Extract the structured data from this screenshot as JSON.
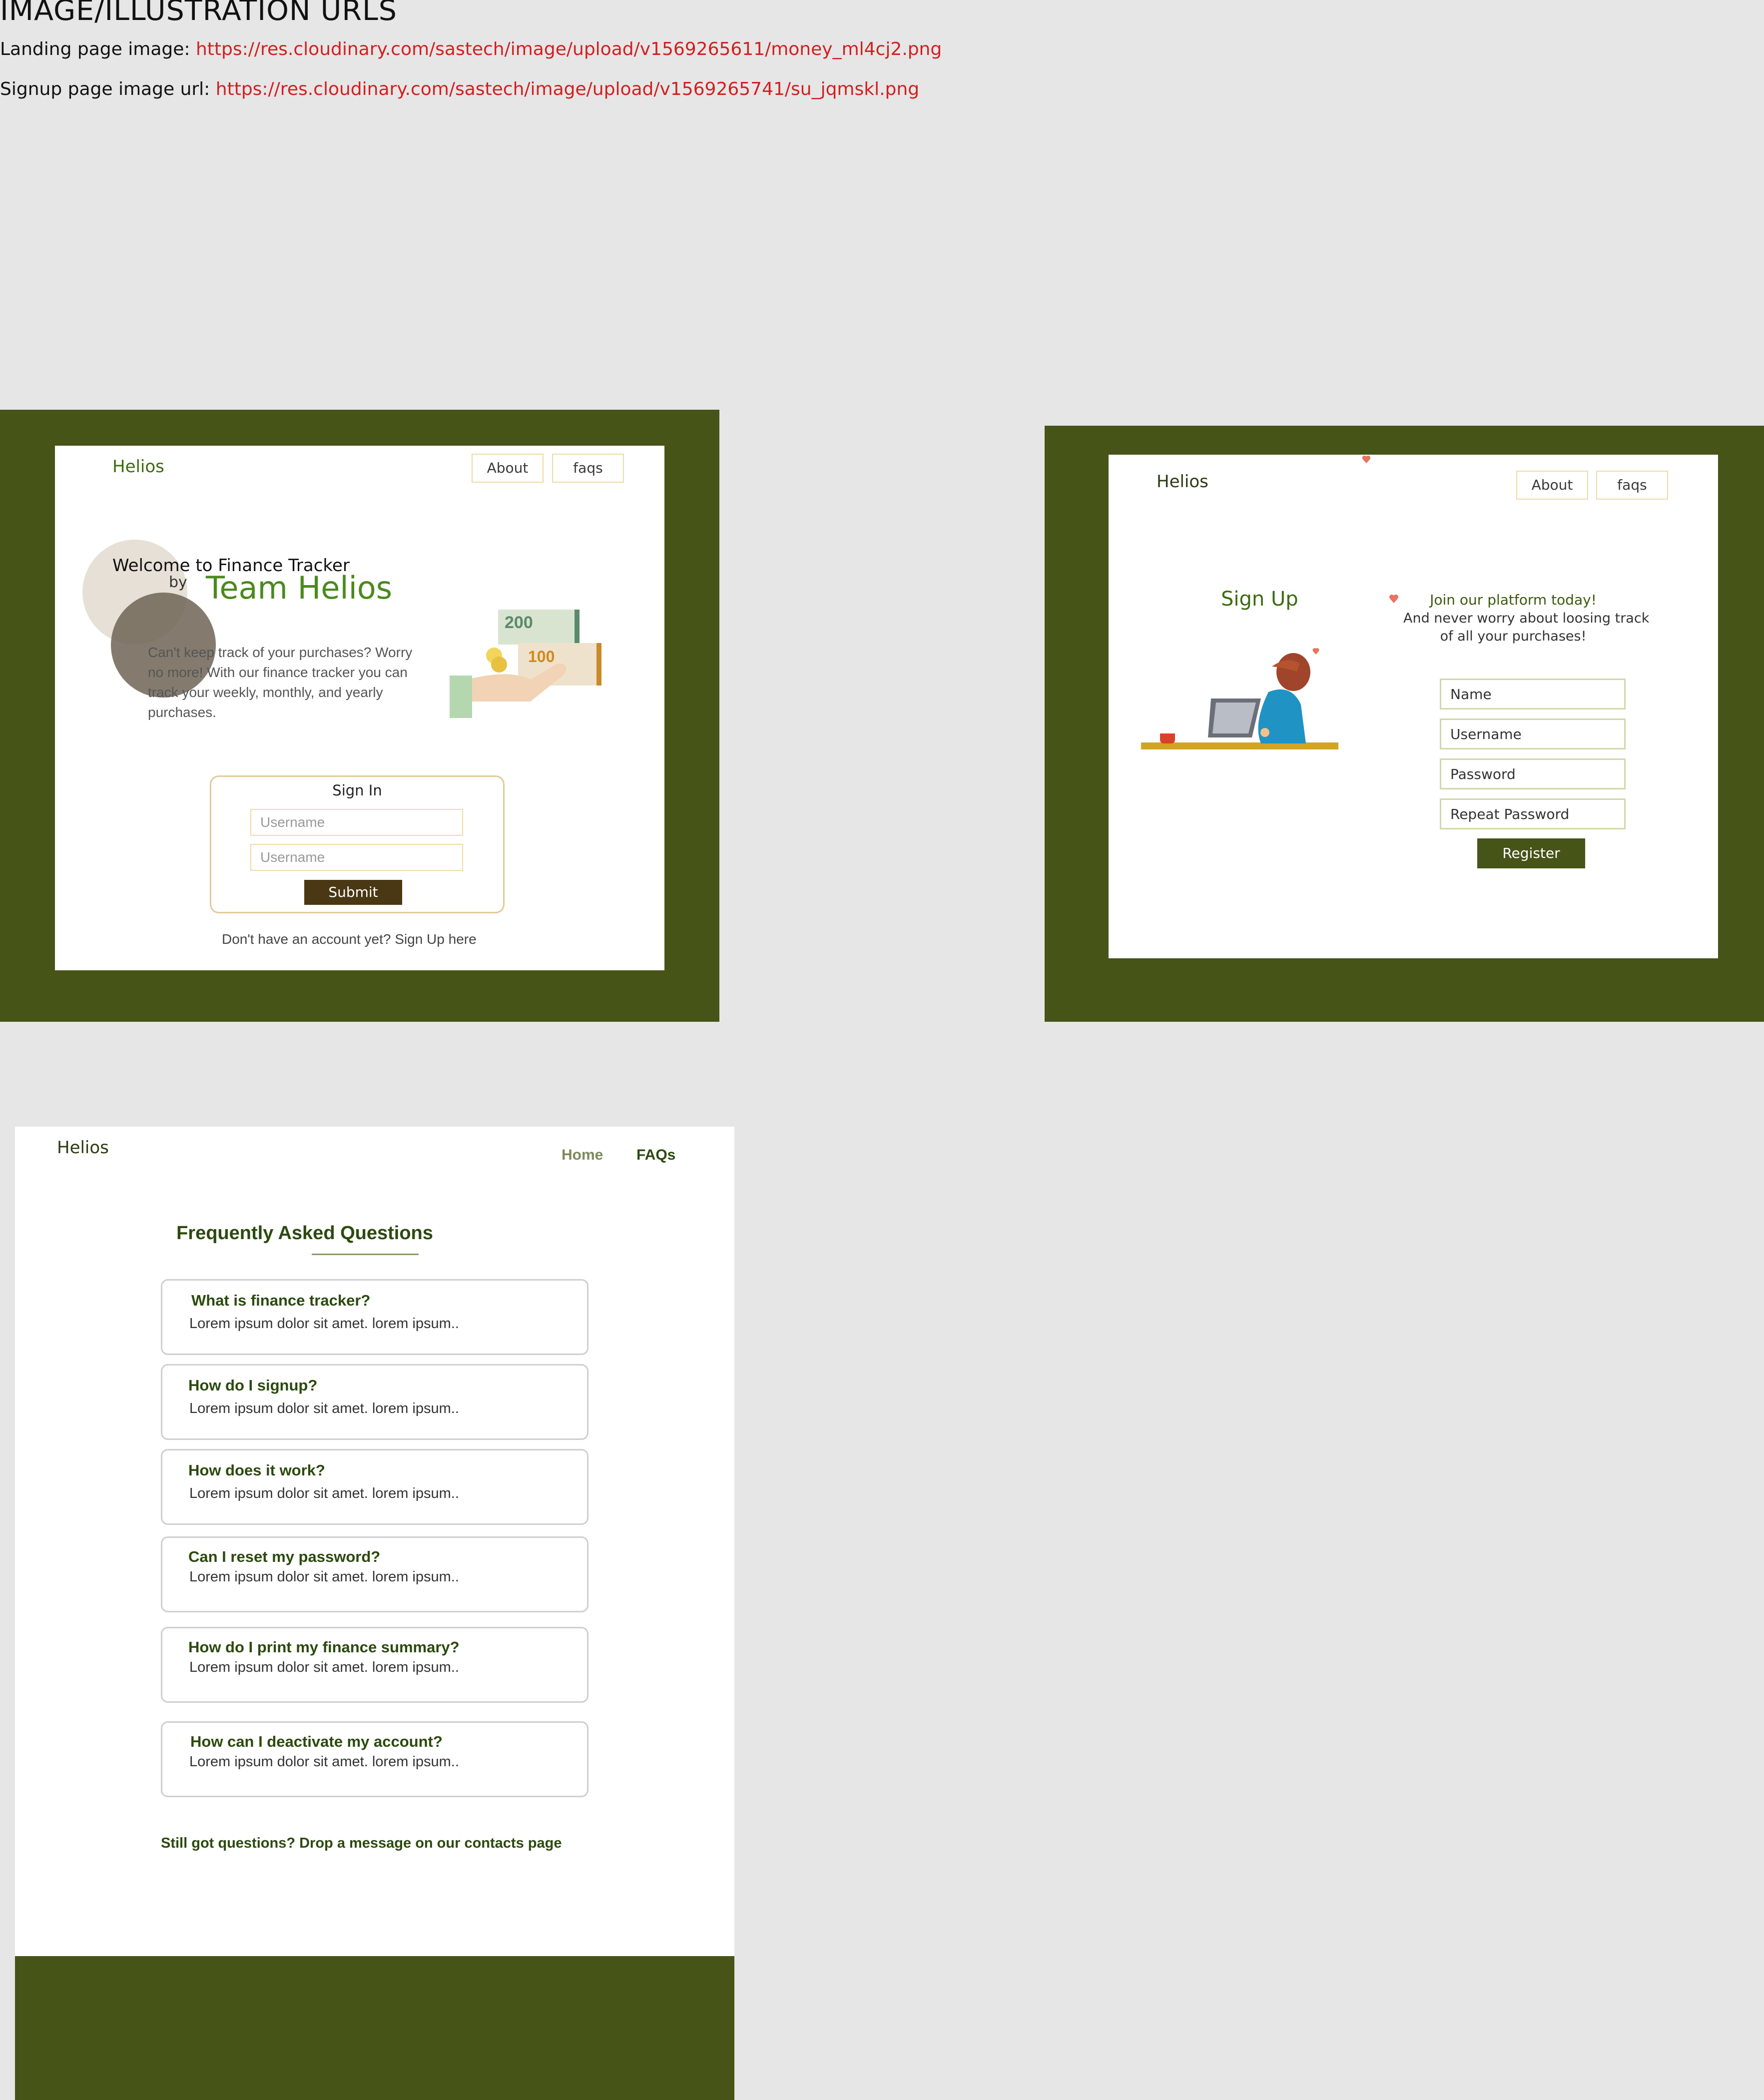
{
  "header": {
    "title": "IMAGE/ILLUSTRATION URLS",
    "landing_label": "Landing page image: ",
    "landing_url": "https://res.cloudinary.com/sastech/image/upload/v1569265611/money_ml4cj2.png",
    "signup_label": "Signup page image url: ",
    "signup_url": "https://res.cloudinary.com/sastech/image/upload/v1569265741/su_jqmskl.png"
  },
  "landing": {
    "brand": "Helios",
    "nav": [
      "About",
      "faqs"
    ],
    "welcome": "Welcome to Finance Tracker",
    "by": "by",
    "team": "Team Helios",
    "blurb": "Can't keep track of your purchases? Worry no more! With our finance tracker you can track your weekly, monthly, and yearly purchases.",
    "money_labels": [
      "200",
      "100"
    ],
    "signin_title": "Sign In",
    "username_placeholder": "Username",
    "password_placeholder": "Username",
    "submit": "Submit",
    "signup_link": "Don't have an account yet? Sign Up here"
  },
  "signup": {
    "brand": "Helios",
    "nav": [
      "About",
      "faqs"
    ],
    "title": "Sign Up",
    "tagline_1": "Join our platform today!",
    "tagline_2": "And never worry about loosing track",
    "tagline_3": "of all your purchases!",
    "fields": [
      "Name",
      "Username",
      "Password",
      "Repeat Password"
    ],
    "register": "Register"
  },
  "faq": {
    "brand": "Helios",
    "nav_home": "Home",
    "nav_faqs": "FAQs",
    "title": "Frequently Asked Questions",
    "items": [
      {
        "q": "What is finance tracker?",
        "a": "Lorem ipsum dolor sit amet. lorem ipsum.."
      },
      {
        "q": "How do I signup?",
        "a": "Lorem ipsum dolor sit amet. lorem ipsum.."
      },
      {
        "q": "How does it work?",
        "a": "Lorem ipsum dolor sit amet. lorem ipsum.."
      },
      {
        "q": "Can I reset my password?",
        "a": "Lorem ipsum dolor sit amet. lorem ipsum.."
      },
      {
        "q": "How do I print my finance summary?",
        "a": "Lorem ipsum dolor sit amet. lorem ipsum.."
      },
      {
        "q": "How can I deactivate my account?",
        "a": "Lorem ipsum dolor sit amet. lorem ipsum.."
      }
    ],
    "footer_note": "Still got questions? Drop a message on our contacts page"
  },
  "colors": {
    "frame_green": "#465418",
    "brand_green": "#3d6b12",
    "link_red": "#d21f1f",
    "submit_brown": "#4a3714"
  }
}
